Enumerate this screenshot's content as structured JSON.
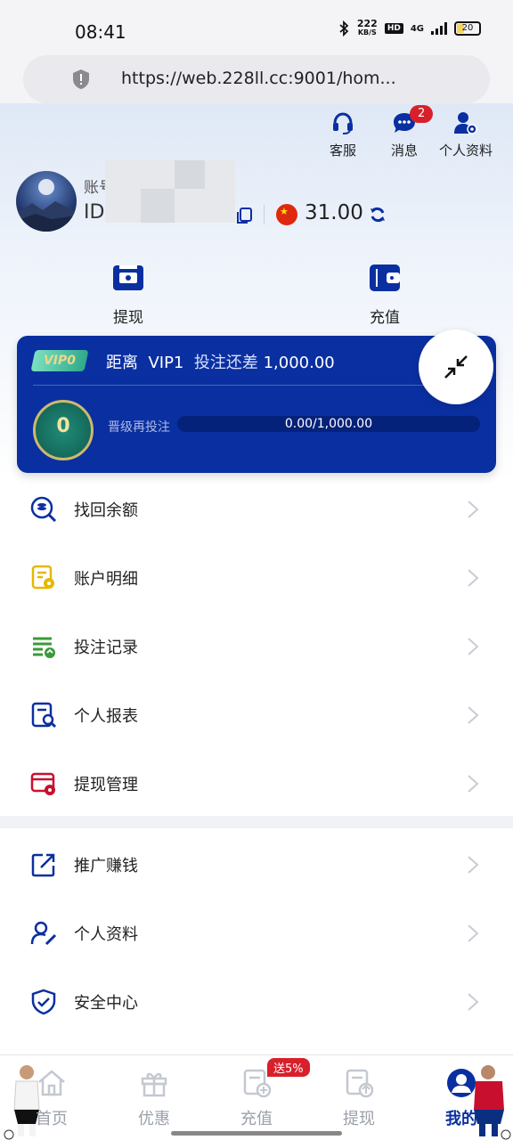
{
  "status_bar": {
    "time": "08:41",
    "net_speed": "222",
    "net_unit": "KB/S",
    "hd": "HD",
    "network": "4G",
    "battery": "20"
  },
  "browser": {
    "url": "https://web.228ll.cc:9001/hom..."
  },
  "header": {
    "actions": [
      {
        "label": "客服",
        "icon": "headset-icon"
      },
      {
        "label": "消息",
        "icon": "chat-bubble-icon",
        "badge": "2"
      },
      {
        "label": "个人资料",
        "icon": "user-settings-icon"
      }
    ]
  },
  "account": {
    "label_prefix": "账号",
    "id_prefix": "ID:",
    "balance": "31.00",
    "currency_flag": "china-flag"
  },
  "quick_actions": [
    {
      "label": "提现",
      "icon": "withdraw-ticket-icon"
    },
    {
      "label": "充值",
      "icon": "wallet-icon"
    }
  ],
  "vip": {
    "tag": "VIP0",
    "distance_text": "距离",
    "next_level": "VIP1",
    "remaining_text": "投注还差",
    "remaining_amount": "1,000.00",
    "level": "0",
    "upgrade_label": "晋级再投注",
    "progress_text": "0.00/1,000.00",
    "progress_fraction": 0.0
  },
  "menu": [
    {
      "label": "找回余额",
      "icon": "search-balance-icon",
      "color": "#0a2fa0"
    },
    {
      "label": "账户明细",
      "icon": "account-detail-icon",
      "color": "#e6b800"
    },
    {
      "label": "投注记录",
      "icon": "bet-record-icon",
      "color": "#3a9a3a"
    },
    {
      "label": "个人报表",
      "icon": "report-search-icon",
      "color": "#0a2fa0"
    },
    {
      "label": "提现管理",
      "icon": "withdraw-manage-icon",
      "color": "#c8102e"
    },
    {
      "label": "推广赚钱",
      "icon": "share-icon",
      "color": "#0a2fa0"
    },
    {
      "label": "个人资料",
      "icon": "user-edit-icon",
      "color": "#0a2fa0"
    },
    {
      "label": "安全中心",
      "icon": "shield-check-icon",
      "color": "#0a2fa0"
    }
  ],
  "tabbar": {
    "tabs": [
      {
        "label": "首页",
        "icon": "home-icon"
      },
      {
        "label": "优惠",
        "icon": "gift-icon"
      },
      {
        "label": "充值",
        "icon": "deposit-icon",
        "promo": "送5%"
      },
      {
        "label": "提现",
        "icon": "withdraw-icon"
      },
      {
        "label": "我的",
        "icon": "profile-icon",
        "active": true
      }
    ]
  },
  "colors": {
    "brand": "#0a2fa0",
    "badge": "#d8202a"
  }
}
